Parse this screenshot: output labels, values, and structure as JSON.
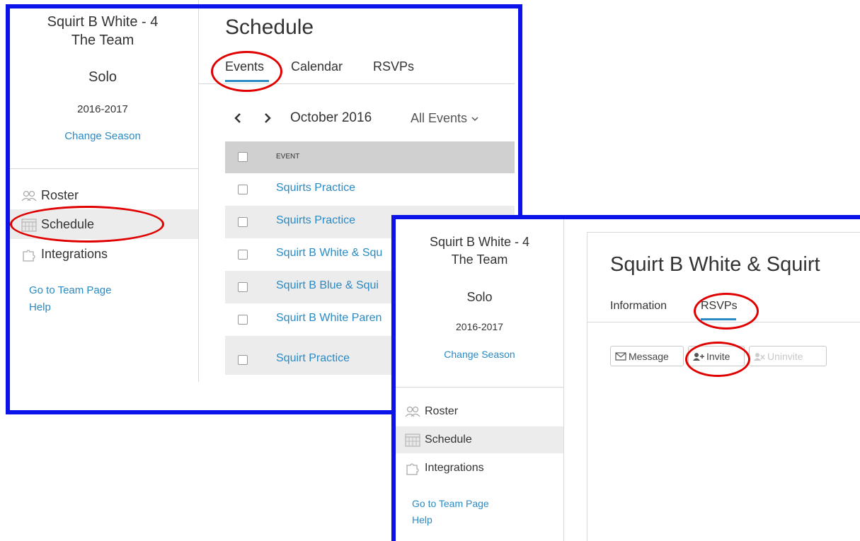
{
  "back_window": {
    "sidebar": {
      "team_line1": "Squirt B White - 4",
      "team_line2": "The Team",
      "plan": "Solo",
      "season": "2016-2017",
      "change_season": "Change Season",
      "nav": [
        {
          "label": "Roster",
          "icon": "roster-icon"
        },
        {
          "label": "Schedule",
          "icon": "calendar-icon"
        },
        {
          "label": "Integrations",
          "icon": "puzzle-icon"
        }
      ],
      "links": [
        "Go to Team Page",
        "Help"
      ]
    },
    "main": {
      "title": "Schedule",
      "tabs": [
        "Events",
        "Calendar",
        "RSVPs"
      ],
      "active_tab": "Events",
      "month": "October 2016",
      "filter": "All Events",
      "table_header": "EVENT",
      "events": [
        "Squirts Practice",
        "Squirts Practice",
        "Squirt B White & Squ",
        "Squirt B Blue & Squi",
        "Squirt B White Paren",
        "Squirt Practice"
      ]
    }
  },
  "front_window": {
    "sidebar": {
      "team_line1": "Squirt B White - 4",
      "team_line2": "The Team",
      "plan": "Solo",
      "season": "2016-2017",
      "change_season": "Change Season",
      "nav": [
        {
          "label": "Roster",
          "icon": "roster-icon"
        },
        {
          "label": "Schedule",
          "icon": "calendar-icon"
        },
        {
          "label": "Integrations",
          "icon": "puzzle-icon"
        }
      ],
      "links": [
        "Go to Team Page",
        "Help"
      ]
    },
    "main": {
      "title": "Squirt B White & Squirt",
      "tabs": [
        "Information",
        "RSVPs"
      ],
      "active_tab": "RSVPs",
      "buttons": {
        "message": "Message",
        "invite": "Invite",
        "uninvite": "Uninvite"
      }
    }
  },
  "colors": {
    "frame": "#0a14e8",
    "highlight": "#e00000",
    "link": "#2a8ac4",
    "tab_underline": "#2a8ac4"
  }
}
